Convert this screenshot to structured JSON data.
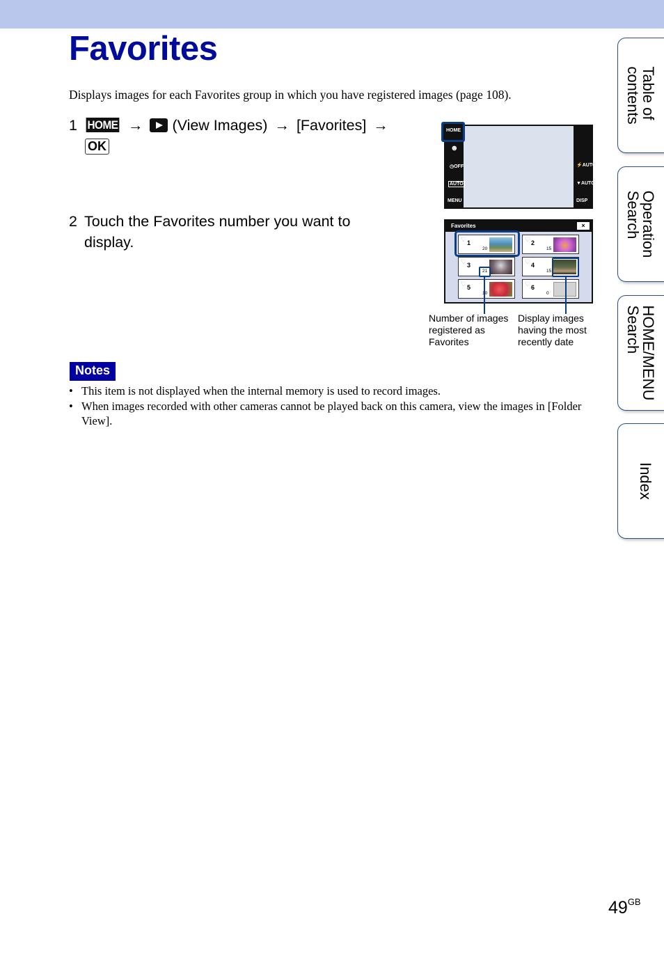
{
  "header": {
    "title": "Favorites"
  },
  "intro": "Displays images for each Favorites group in which you have registered images (page 108).",
  "steps": [
    {
      "number": "1",
      "home_icon": "HOME",
      "arrow": "→",
      "view_images_label": "(View Images)",
      "favorites_label": "[Favorites]",
      "ok_icon": "OK"
    },
    {
      "number": "2",
      "text_line1": "Touch the Favorites number you want to",
      "text_line2": "display."
    }
  ],
  "screen1": {
    "left_icons": [
      "HOME",
      "face-detection-icon",
      "self-timer-off-icon",
      "scene-auto-icon",
      "MENU"
    ],
    "home_label": "HOME",
    "menu_label": "MENU",
    "timer_label": "OFF",
    "scene_label": "AUTO",
    "flash_label": "AUTO",
    "iso_label": "AUTO",
    "disp_label": "DISP"
  },
  "screen2": {
    "title": "Favorites",
    "close_label": "×",
    "groups": [
      {
        "number": "1",
        "count": "20"
      },
      {
        "number": "2",
        "count": "15"
      },
      {
        "number": "3",
        "count": "21"
      },
      {
        "number": "4",
        "count": "15"
      },
      {
        "number": "5",
        "count": "10"
      },
      {
        "number": "6",
        "count": "0"
      }
    ]
  },
  "callouts": {
    "left_line1": "Number of images",
    "left_line2": "registered as",
    "left_line3": "Favorites",
    "right_line1": "Display images",
    "right_line2": "having the most",
    "right_line3": "recently date"
  },
  "notes": {
    "badge": "Notes",
    "items": [
      "This item is not displayed when the internal memory is used to record images.",
      "When images recorded with other cameras cannot be played back on this camera, view the images in [Folder View]."
    ]
  },
  "side_tabs": [
    {
      "line1": "Table of",
      "line2": "contents"
    },
    {
      "line1": "Operation",
      "line2": "Search"
    },
    {
      "line1": "HOME/MENU",
      "line2": "Search"
    },
    {
      "line1": "Index",
      "line2": ""
    }
  ],
  "page": {
    "number": "49",
    "suffix": "GB"
  },
  "colors": {
    "accent": "#000c99",
    "band": "#b8c7eb",
    "highlight": "#0a3d86",
    "notes_bg": "#0000a0"
  }
}
